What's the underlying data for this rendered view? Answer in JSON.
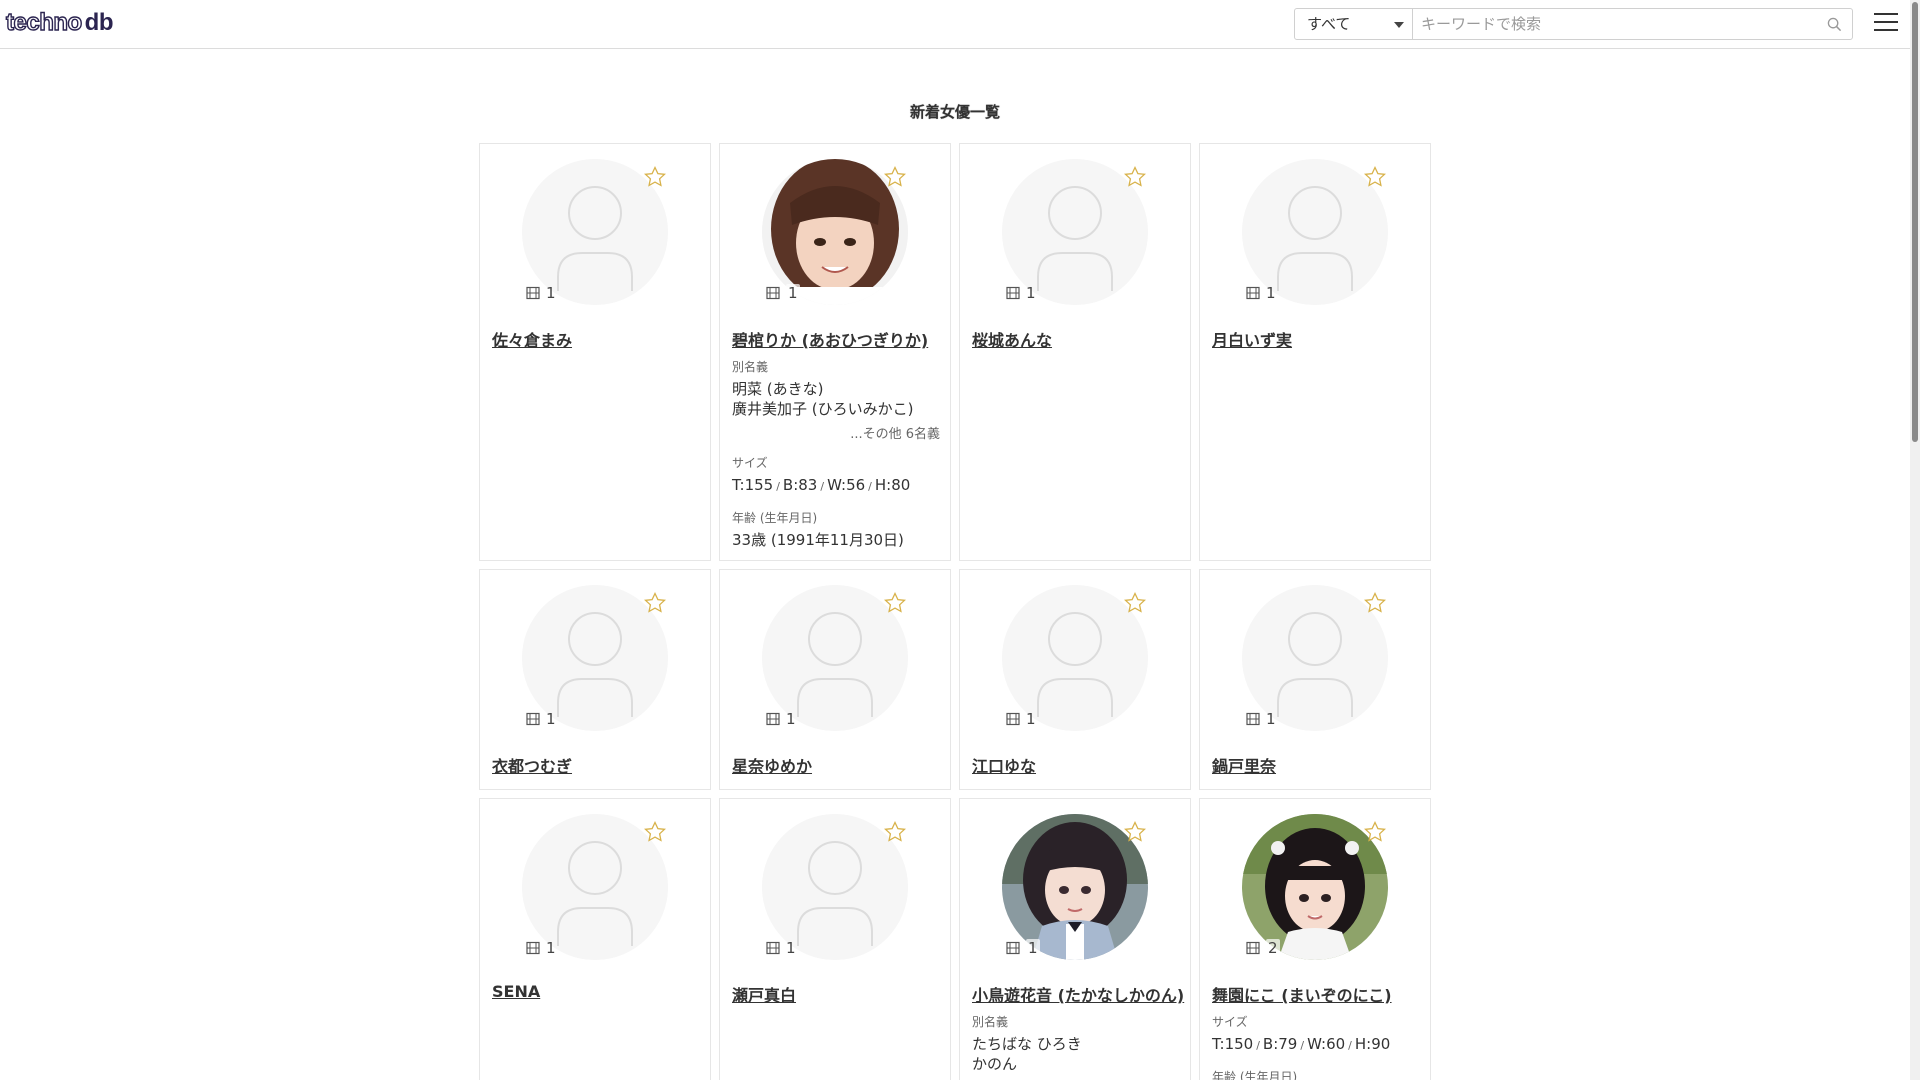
{
  "header": {
    "logo_part1": "techno",
    "logo_part2": "db",
    "search": {
      "select_value": "すべて",
      "placeholder": "キーワードで検索"
    }
  },
  "page_title": "新着女優一覧",
  "actresses": [
    {
      "name": "佐々倉まみ",
      "count": "1"
    },
    {
      "name": "碧棺りか (あおひつぎりか)",
      "count": "1",
      "alias_label": "別名義",
      "aliases": [
        "明菜 (あきな)",
        "廣井美加子 (ひろいみかこ)"
      ],
      "alias_more": "...その他 6名義",
      "size_label": "サイズ",
      "size": {
        "t": "T:155",
        "b": "B:83",
        "w": "W:56",
        "h": "H:80"
      },
      "age_label": "年齢 (生年月日)",
      "age": "33歳 (1991年11月30日)"
    },
    {
      "name": "桜城あんな",
      "count": "1"
    },
    {
      "name": "月白いず実",
      "count": "1"
    },
    {
      "name": "衣都つむぎ",
      "count": "1"
    },
    {
      "name": "星奈ゆめか",
      "count": "1"
    },
    {
      "name": "江口ゆな",
      "count": "1"
    },
    {
      "name": "鍋戸里奈",
      "count": "1"
    },
    {
      "name": "SENA",
      "count": "1"
    },
    {
      "name": "瀬戸真白",
      "count": "1"
    },
    {
      "name": "小鳥遊花音 (たかなしかのん)",
      "count": "1",
      "alias_label": "別名義",
      "aliases": [
        "たちばな ひろき",
        "かのん"
      ]
    },
    {
      "name": "舞園にこ (まいぞのにこ)",
      "count": "2",
      "size_label": "サイズ",
      "size": {
        "t": "T:150",
        "b": "B:79",
        "w": "W:60",
        "h": "H:90"
      },
      "age_label": "年齢 (生年月日)"
    }
  ]
}
